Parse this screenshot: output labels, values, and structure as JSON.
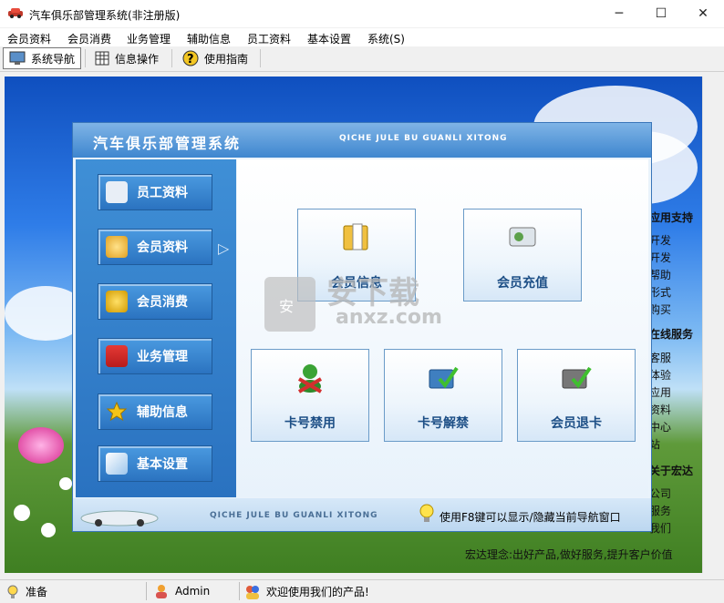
{
  "window": {
    "title": "汽车俱乐部管理系统(非注册版)",
    "btn_min": "─",
    "btn_max": "☐",
    "btn_close": "✕"
  },
  "menu": [
    "会员资料",
    "会员消费",
    "业务管理",
    "辅助信息",
    "员工资料",
    "基本设置",
    "系统(S)"
  ],
  "toolbar": [
    "系统导航",
    "信息操作",
    "使用指南"
  ],
  "toolbar_icons": [
    "monitor-icon",
    "grid-icon",
    "help-icon"
  ],
  "panel": {
    "title": "汽车俱乐部管理系统",
    "title_en": "QICHE JULE BU GUANLI XITONG",
    "footer_en": "QICHE JULE BU GUANLI XITONG",
    "tip": "使用F8键可以显示/隐藏当前导航窗口"
  },
  "nav": [
    "员工资料",
    "会员资料",
    "会员消费",
    "业务管理",
    "辅助信息",
    "基本设置"
  ],
  "nav_icons": [
    "staff-icon",
    "member-icon",
    "coins-icon",
    "monitor-icon",
    "star-icon",
    "settings-icon"
  ],
  "cards": [
    "会员信息",
    "会员充值",
    "卡号禁用",
    "卡号解禁",
    "会员退卡"
  ],
  "card_icons": [
    "folder-icon",
    "recharge-icon",
    "ban-icon",
    "unban-icon",
    "refund-icon"
  ],
  "right_list": [
    "应用支持",
    "开发",
    "开发",
    "帮助",
    "形式",
    "购买",
    "在线服务",
    "客服",
    "体验",
    "应用",
    "资料",
    "中心",
    "站",
    "关于宏达",
    "公司",
    "服务",
    "我们"
  ],
  "slogan": "宏达理念:出好产品,做好服务,提升客户价值",
  "watermark": {
    "cn": "安下载",
    "en": "anxz.com"
  },
  "status": {
    "ready": "准备",
    "user": "Admin",
    "welcome": "欢迎使用我们的产品!"
  },
  "colors": {
    "accent": "#3e86cf",
    "card_text": "#1d4f86"
  }
}
